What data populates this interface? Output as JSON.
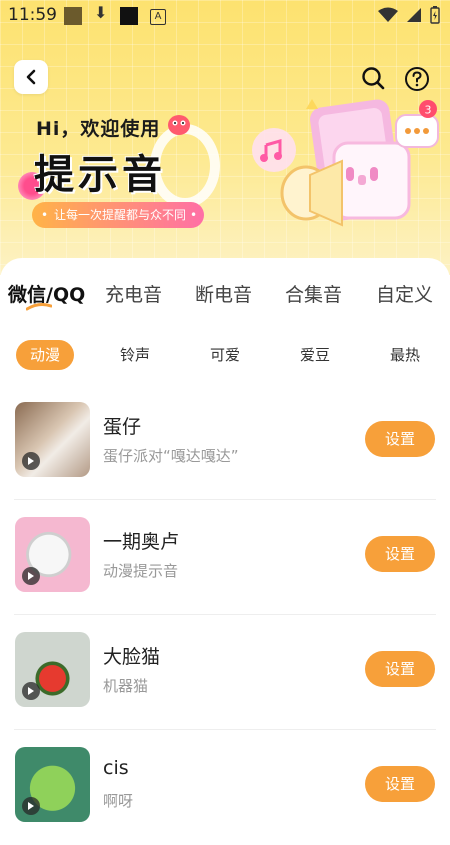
{
  "status_bar": {
    "time": "11:59",
    "notif_letter": "A"
  },
  "hero": {
    "greeting": "Hi，欢迎使用",
    "title": "提示音",
    "tagline": "让每一次提醒都与众不同",
    "badge_count": "3"
  },
  "tabs": [
    {
      "label": "微信/QQ",
      "active": true
    },
    {
      "label": "充电音"
    },
    {
      "label": "断电音"
    },
    {
      "label": "合集音"
    },
    {
      "label": "自定义"
    }
  ],
  "chips": [
    {
      "label": "动漫",
      "active": true
    },
    {
      "label": "铃声"
    },
    {
      "label": "可爱"
    },
    {
      "label": "爱豆"
    },
    {
      "label": "最热"
    }
  ],
  "items": [
    {
      "title": "蛋仔",
      "subtitle": "蛋仔派对“嘎达嘎达”",
      "button": "设置"
    },
    {
      "title": "一期奥卢",
      "subtitle": "动漫提示音",
      "button": "设置"
    },
    {
      "title": "大脸猫",
      "subtitle": "机器猫",
      "button": "设置"
    },
    {
      "title": "cis",
      "subtitle": "啊呀",
      "button": "设置"
    }
  ],
  "colors": {
    "accent": "#f7a03a",
    "hero_bg": "#fde26f"
  }
}
